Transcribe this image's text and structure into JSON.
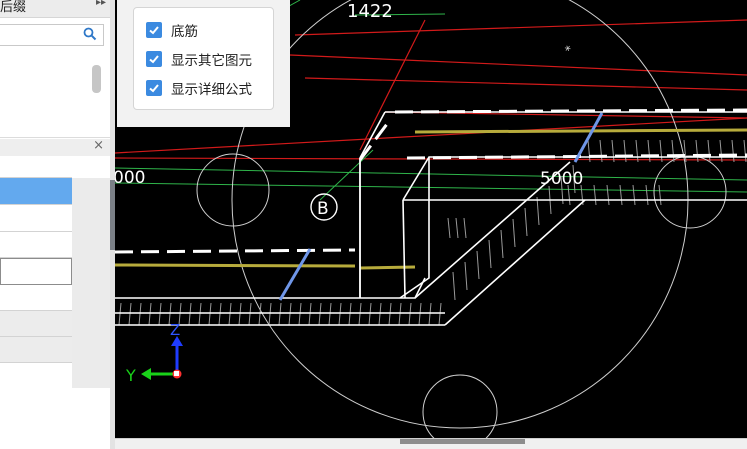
{
  "left_panel": {
    "title_fragment": "后缀",
    "expand_icon": "double-chevron-right-icon",
    "search_icon": "search-icon",
    "close_icon": "close-icon"
  },
  "options": [
    {
      "label": "底筋",
      "checked": true
    },
    {
      "label": "显示其它图元",
      "checked": true
    },
    {
      "label": "显示详细公式",
      "checked": true
    }
  ],
  "drawing": {
    "dimension_top": "1422",
    "dimension_left": "000",
    "dimension_right": "5000",
    "axis_label": "B",
    "axis_y": "Y",
    "axis_z": "Z",
    "colors": {
      "background": "#000000",
      "red_lines": "#d21a1a",
      "green_lines": "#2fb44a",
      "rebar_yellow": "#b7ab3c",
      "stirrup_blue": "#6f96e8",
      "outline": "#ffffff",
      "axis_y": "#19d219",
      "axis_z": "#1f3cff"
    }
  }
}
